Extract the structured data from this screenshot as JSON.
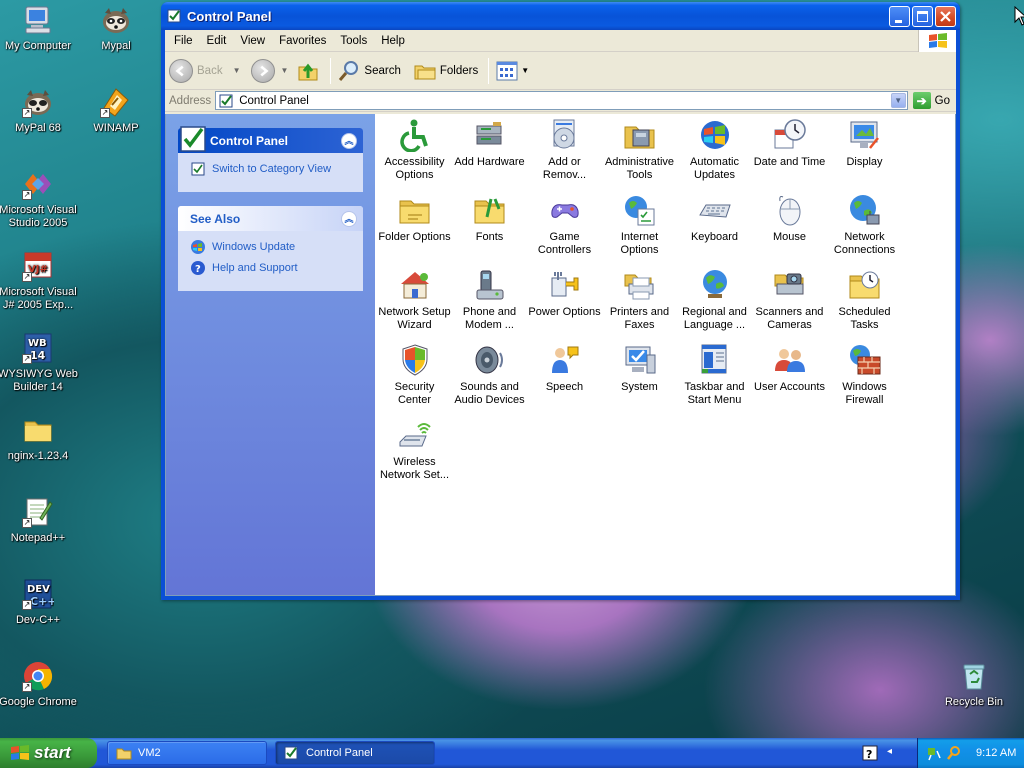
{
  "desktop": {
    "icons": [
      {
        "label": "My Computer",
        "icon": "my-computer-icon"
      },
      {
        "label": "Mypal",
        "icon": "mypal-icon"
      },
      {
        "label": "MyPal 68",
        "icon": "mypal68-icon"
      },
      {
        "label": "WINAMP",
        "icon": "winamp-icon"
      },
      {
        "label": "Microsoft Visual Studio 2005",
        "icon": "visual-studio-icon"
      },
      {
        "label": "Microsoft Visual J# 2005 Exp...",
        "icon": "visual-jsharp-icon"
      },
      {
        "label": "WYSIWYG Web Builder 14",
        "icon": "wysiwyg-icon"
      },
      {
        "label": "nginx-1.23.4",
        "icon": "folder-icon"
      },
      {
        "label": "Notepad++",
        "icon": "notepadpp-icon"
      },
      {
        "label": "Dev-C++",
        "icon": "devcpp-icon"
      },
      {
        "label": "Google Chrome",
        "icon": "chrome-icon"
      },
      {
        "label": "Recycle Bin",
        "icon": "recycle-bin-icon"
      }
    ]
  },
  "window": {
    "title": "Control Panel",
    "menu": [
      "File",
      "Edit",
      "View",
      "Favorites",
      "Tools",
      "Help"
    ],
    "toolbar": {
      "back": "Back",
      "search": "Search",
      "folders": "Folders"
    },
    "address": {
      "label": "Address",
      "value": "Control Panel",
      "go": "Go"
    },
    "taskpane": {
      "main_title": "Control Panel",
      "switch_link": "Switch to Category View",
      "see_also_title": "See Also",
      "see_also_links": [
        "Windows Update",
        "Help and Support"
      ]
    },
    "items": [
      {
        "label": "Accessibility Options",
        "icon": "accessibility-icon"
      },
      {
        "label": "Add Hardware",
        "icon": "add-hardware-icon"
      },
      {
        "label": "Add or Remov...",
        "icon": "add-remove-icon"
      },
      {
        "label": "Administrative Tools",
        "icon": "admin-tools-icon"
      },
      {
        "label": "Automatic Updates",
        "icon": "auto-updates-icon"
      },
      {
        "label": "Date and Time",
        "icon": "date-time-icon"
      },
      {
        "label": "Display",
        "icon": "display-icon"
      },
      {
        "label": "Folder Options",
        "icon": "folder-options-icon"
      },
      {
        "label": "Fonts",
        "icon": "fonts-icon"
      },
      {
        "label": "Game Controllers",
        "icon": "game-controllers-icon"
      },
      {
        "label": "Internet Options",
        "icon": "internet-options-icon"
      },
      {
        "label": "Keyboard",
        "icon": "keyboard-icon"
      },
      {
        "label": "Mouse",
        "icon": "mouse-icon"
      },
      {
        "label": "Network Connections",
        "icon": "network-connections-icon"
      },
      {
        "label": "Network Setup Wizard",
        "icon": "network-setup-icon"
      },
      {
        "label": "Phone and Modem ...",
        "icon": "phone-modem-icon"
      },
      {
        "label": "Power Options",
        "icon": "power-options-icon"
      },
      {
        "label": "Printers and Faxes",
        "icon": "printers-icon"
      },
      {
        "label": "Regional and Language ...",
        "icon": "regional-icon"
      },
      {
        "label": "Scanners and Cameras",
        "icon": "scanners-icon"
      },
      {
        "label": "Scheduled Tasks",
        "icon": "scheduled-tasks-icon"
      },
      {
        "label": "Security Center",
        "icon": "security-center-icon"
      },
      {
        "label": "Sounds and Audio Devices",
        "icon": "sounds-icon"
      },
      {
        "label": "Speech",
        "icon": "speech-icon"
      },
      {
        "label": "System",
        "icon": "system-icon"
      },
      {
        "label": "Taskbar and Start Menu",
        "icon": "taskbar-start-icon"
      },
      {
        "label": "User Accounts",
        "icon": "user-accounts-icon"
      },
      {
        "label": "Windows Firewall",
        "icon": "firewall-icon"
      },
      {
        "label": "Wireless Network Set...",
        "icon": "wireless-icon"
      }
    ]
  },
  "taskbar": {
    "start": "start",
    "tasks": [
      "VM2",
      "Control Panel"
    ],
    "clock": "9:12 AM"
  }
}
